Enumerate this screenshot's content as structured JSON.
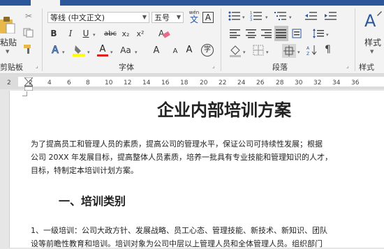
{
  "font": {
    "name": "等线 (中文正文)",
    "size": "五号",
    "buttons": {
      "pinyin": "wén",
      "pinyin_char": "文",
      "border_char": "A",
      "bold": "B",
      "italic": "I",
      "underline": "U",
      "strike": "abc",
      "subscript": "x₂",
      "superscript": "x²",
      "effects": "A",
      "highlight": "ab",
      "fontcolor": "A",
      "aa": "Aa",
      "grow": "A",
      "shrink": "A",
      "phonetic": "A",
      "enclose": "字"
    },
    "group_label": "字体"
  },
  "clipboard": {
    "paste_label": "粘贴",
    "group_label": "剪贴板"
  },
  "paragraph": {
    "group_label": "段落"
  },
  "styles": {
    "label": "样式",
    "group_label": "样式"
  },
  "ruler": {
    "ticks": [
      "2",
      "2",
      "4",
      "6",
      "8",
      "10",
      "12",
      "14",
      "16",
      "18",
      "20",
      "22",
      "24",
      "26",
      "28",
      "30",
      "32",
      "34",
      "36"
    ]
  },
  "document": {
    "title": "企业内部培训方案",
    "para1_line1": "为了提高员工和管理人员的素质，提高公司的管理水平，保证公司可持续性发展；根据",
    "para1_line2": "公司 20XX 年发展目标，提高整体人员素质，培养一批具有专业技能和管理知识的人才，",
    "para1_line3": "目标，特制定本培训计划方案。",
    "heading1": "一、培训类别",
    "para2_line1": "1、一级培训：公司大政方针、发展战略、员工心态、管理技能、新技术、新知识、团队",
    "para2_line2": "设等前瞻性教育和培训。培训对象为公司中层以上管理人员和全体管理人员。组织部门"
  },
  "colors": {
    "accent": "#2b579a",
    "highlight": "#ffff00",
    "fontcolor": "#e02020",
    "paste": "#e8b84a"
  }
}
